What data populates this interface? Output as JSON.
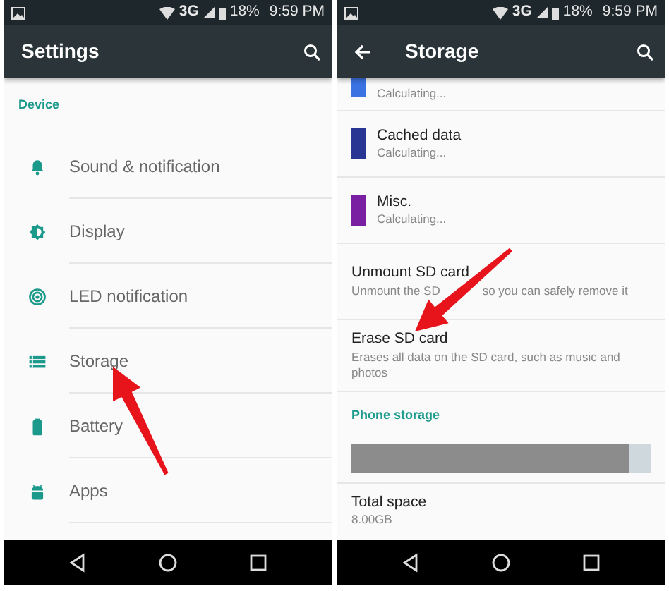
{
  "screens": [
    {
      "status_bar": {
        "network": "3G",
        "battery": "18%",
        "time": "9:59 PM"
      },
      "app_bar": {
        "title": "Settings",
        "back_button": false
      },
      "content": [
        {
          "kind": "header",
          "text": "Device"
        },
        {
          "kind": "setting",
          "title": "Sound & notification"
        },
        {
          "kind": "setting",
          "title": "Display"
        },
        {
          "kind": "setting",
          "title": "LED notification"
        },
        {
          "kind": "setting",
          "title": "Storage"
        },
        {
          "kind": "setting",
          "title": "Battery"
        },
        {
          "kind": "setting",
          "title": "Apps"
        }
      ]
    },
    {
      "status_bar": {
        "network": "3G",
        "battery": "18%",
        "time": "9:59 PM"
      },
      "app_bar": {
        "title": "Storage",
        "back_button": true
      },
      "content": [
        {
          "kind": "category",
          "color": "#3b73e3",
          "subtitle": "Calculating..."
        },
        {
          "kind": "category",
          "color": "#283593",
          "title": "Cached data",
          "subtitle": "Calculating..."
        },
        {
          "kind": "category",
          "color": "#7b1fa2",
          "title": "Misc.",
          "subtitle": "Calculating..."
        },
        {
          "kind": "action",
          "title": "Unmount SD card",
          "subtitle": "Unmount the SD",
          "subtitle_end": "so you can safely remove it"
        },
        {
          "kind": "action",
          "title": "Erase SD card",
          "subtitle": "Erases all data on the SD card, such as music and photos"
        },
        {
          "kind": "header",
          "text": "Phone storage"
        },
        {
          "kind": "bar",
          "level": 0.93
        },
        {
          "kind": "info",
          "title": "Total space",
          "subtitle": "8.00GB"
        }
      ]
    }
  ]
}
